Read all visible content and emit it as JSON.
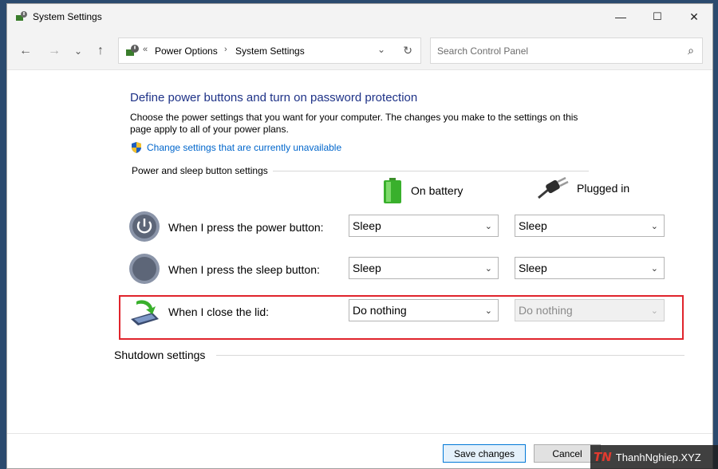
{
  "window": {
    "title": "System Settings"
  },
  "titlebar": {
    "minimize": "—",
    "maximize": "☐",
    "close": "✕"
  },
  "nav": {
    "back": "←",
    "forward": "→",
    "recent": "⌄",
    "up": "↑",
    "address": {
      "separator_left": "«",
      "crumbs": [
        "Power Options",
        "System Settings"
      ],
      "separator": "›",
      "dropdown": "⌄",
      "refresh": "↻"
    },
    "search": {
      "placeholder": "Search Control Panel",
      "icon": "⌕"
    }
  },
  "main": {
    "heading": "Define power buttons and turn on password protection",
    "description": "Choose the power settings that you want for your computer. The changes you make to the settings on this page apply to all of your power plans.",
    "uac_link": "Change settings that are currently unavailable",
    "group_label": "Power and sleep button settings",
    "columns": {
      "battery": "On battery",
      "plugged": "Plugged in"
    },
    "rows": [
      {
        "label": "When I press the power button:",
        "battery": "Sleep",
        "plugged": "Sleep"
      },
      {
        "label": "When I press the sleep button:",
        "battery": "Sleep",
        "plugged": "Sleep"
      },
      {
        "label": "When I close the lid:",
        "battery": "Do nothing",
        "plugged": "Do nothing"
      }
    ],
    "shutdown_label": "Shutdown settings"
  },
  "footer": {
    "save": "Save changes",
    "cancel": "Cancel"
  },
  "watermark": {
    "logo": "TN",
    "text": "ThanhNghiep.XYZ"
  },
  "colors": {
    "heading": "#1e3287",
    "link": "#0066cc",
    "highlight": "#e0242c"
  }
}
